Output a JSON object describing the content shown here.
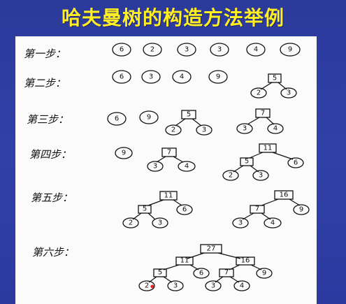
{
  "title": "哈夫曼树的构造方法举例",
  "steps": [
    {
      "label": "第一步："
    },
    {
      "label": "第二步："
    },
    {
      "label": "第三步："
    },
    {
      "label": "第四步："
    },
    {
      "label": "第五步："
    },
    {
      "label": "第六步："
    }
  ],
  "colors": {
    "background": "#2f3ea6",
    "title": "#ffee22",
    "paper": "#fbfbfb"
  }
}
